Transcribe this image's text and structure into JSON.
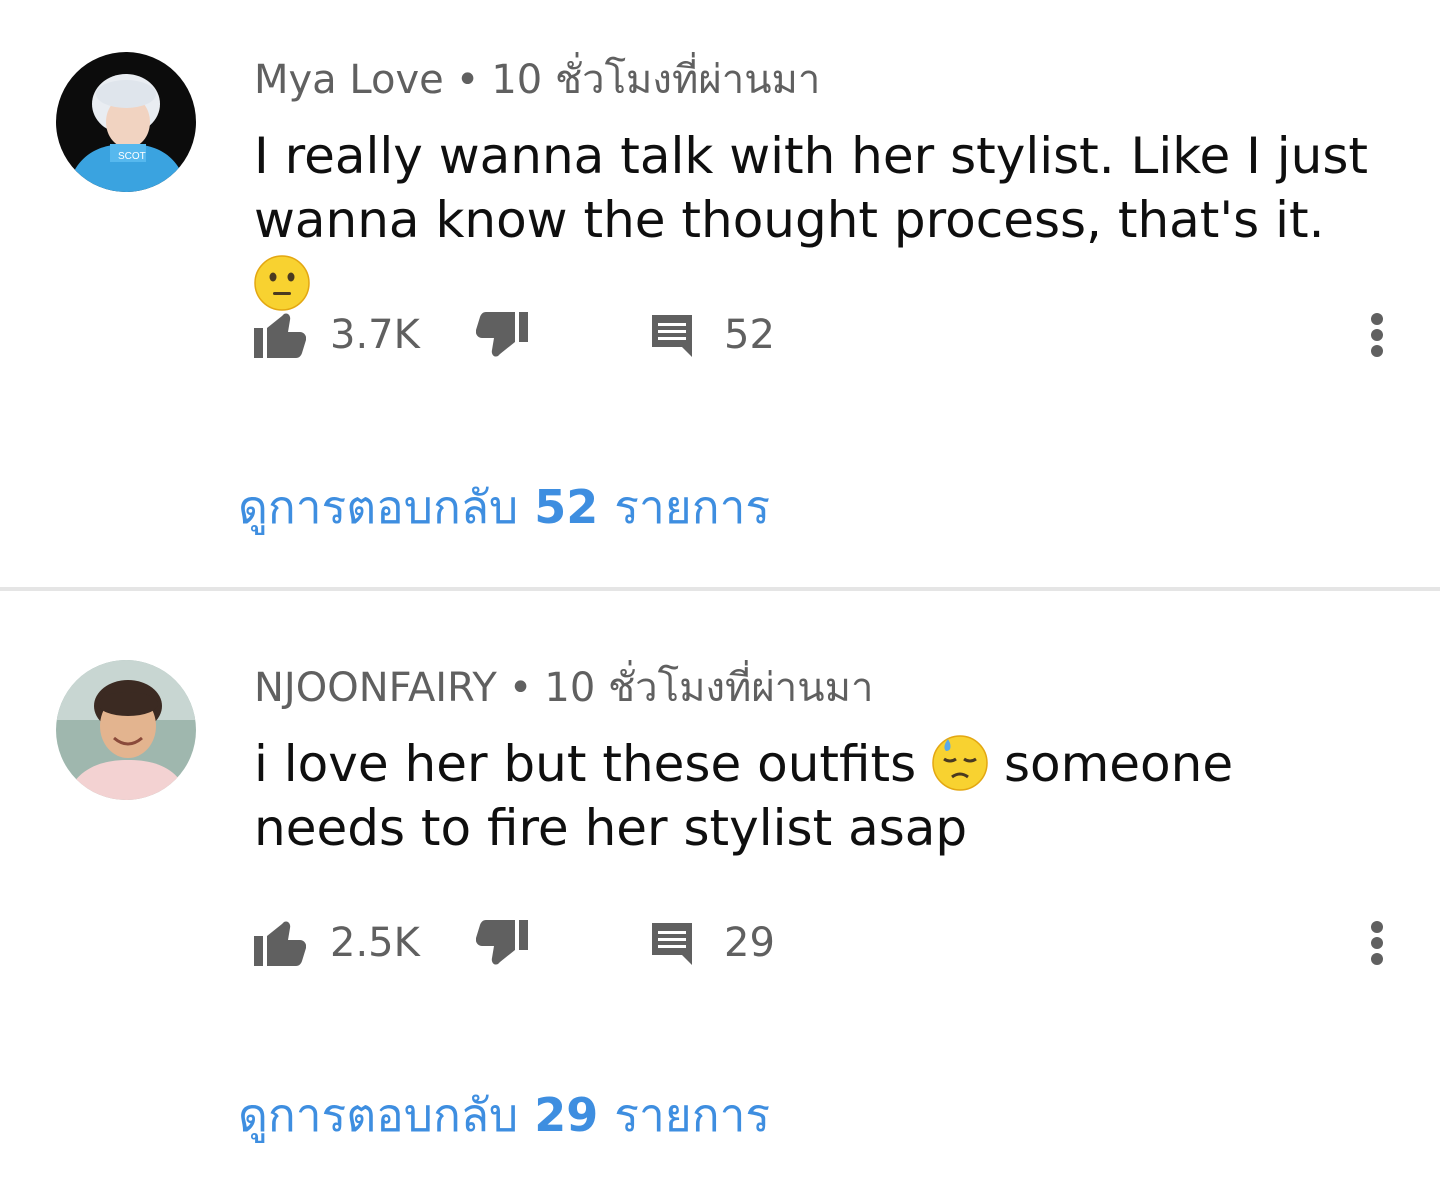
{
  "comments": [
    {
      "author": "Mya Love",
      "separator": "•",
      "time": "10 ชั่วโมงที่ผ่านมา",
      "text": "I really wanna talk with her stylist. Like I just wanna know the thought process, that's it.",
      "emoji": "neutral-face-emoji",
      "likes": "3.7K",
      "replies": "52",
      "view_replies_prefix": "ดูการตอบกลับ",
      "view_replies_count": "52",
      "view_replies_suffix": "รายการ"
    },
    {
      "author": "NJOONFAIRY",
      "separator": "•",
      "time": "10 ชั่วโมงที่ผ่านมา",
      "text_before": "i love her but these outfits",
      "emoji": "downcast-face-with-sweat-emoji",
      "text_after": "someone needs to fire her stylist asap",
      "likes": "2.5K",
      "replies": "29",
      "view_replies_prefix": "ดูการตอบกลับ",
      "view_replies_count": "29",
      "view_replies_suffix": "รายการ"
    }
  ],
  "colors": {
    "link": "#3e8ee0",
    "meta": "#606060",
    "text": "#0f0f0f",
    "divider": "#e5e5e5"
  },
  "icons": [
    "thumbs-up-icon",
    "thumbs-down-icon",
    "comment-icon",
    "more-vert-icon"
  ]
}
